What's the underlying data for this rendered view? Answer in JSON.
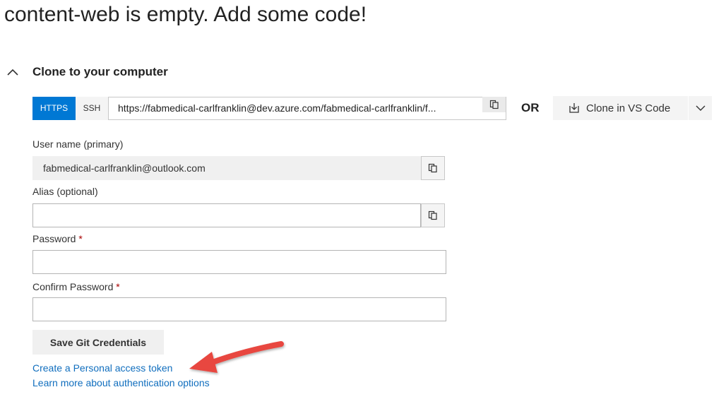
{
  "page": {
    "title": "content-web is empty. Add some code!"
  },
  "clone_section": {
    "title": "Clone to your computer",
    "toggle_icon": "chevron-up-icon",
    "protocols": {
      "https_label": "HTTPS",
      "ssh_label": "SSH",
      "selected": "HTTPS"
    },
    "url": "https://fabmedical-carlfranklin@dev.azure.com/fabmedical-carlfranklin/f...",
    "or_label": "OR",
    "clone_button_label": "Clone in VS Code",
    "clone_button_icon": "download-icon",
    "dropdown_icon": "chevron-down-icon"
  },
  "credentials": {
    "username_label": "User name (primary)",
    "username_value": "fabmedical-carlfranklin@outlook.com",
    "alias_label": "Alias (optional)",
    "alias_value": "",
    "password_label": "Password",
    "confirm_password_label": "Confirm Password",
    "required_marker": "*",
    "save_button_label": "Save Git Credentials",
    "copy_icon": "copy-icon"
  },
  "links": {
    "personal_access_token": "Create a Personal access token",
    "learn_more": "Learn more about authentication options"
  },
  "colors": {
    "accent": "#0078d4",
    "link": "#106ebe",
    "required": "#a80000",
    "annotation_arrow": "#e8473f"
  }
}
